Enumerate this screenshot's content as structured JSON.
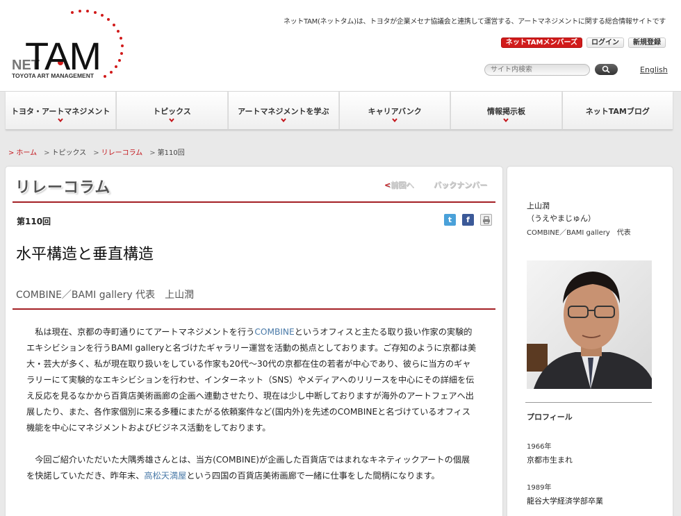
{
  "header": {
    "logo_net": "NET",
    "logo_tam": "TAM",
    "logo_sub": "TOYOTA ART MANAGEMENT",
    "tagline": "ネットTAM(ネットタム)は、トヨタが企業メセナ協議会と連携して運営する、アートマネジメントに関する総合情報サイトです",
    "members_btn": "ネットTAMメンバーズ",
    "login_btn": "ログイン",
    "register_btn": "新規登録",
    "search_placeholder": "サイト内検索",
    "english_link": "English",
    "accent_color": "#c4161c"
  },
  "nav": {
    "items": [
      {
        "label": "トヨタ・アートマネジメント"
      },
      {
        "label": "トピックス"
      },
      {
        "label": "アートマネジメントを学ぶ"
      },
      {
        "label": "キャリアバンク"
      },
      {
        "label": "情報掲示板"
      },
      {
        "label": "ネットTAMブログ"
      }
    ]
  },
  "breadcrumb": {
    "home": "ホーム",
    "topics": "トピックス",
    "relay": "リレーコラム",
    "current": "第110回",
    "separator": ">"
  },
  "main": {
    "section_title": "リレーコラム",
    "prev_link": "前回へ",
    "prev_arrow": "<",
    "backnumber_link": "バックナンバー",
    "issue_no": "第110回",
    "article_title": "水平構造と垂直構造",
    "author_line": "COMBINE／BAMI gallery 代表　上山潤",
    "paragraphs": [
      {
        "before": "私は現在、京都の寺町通りにてアートマネジメントを行う",
        "link": "COMBINE",
        "after": "というオフィスと主たる取り扱い作家の実験的エキシビションを行うBAMI galleryと名づけたギャラリー運営を活動の拠点としております。ご存知のように京都は美大・芸大が多く、私が現在取り扱いをしている作家も20代〜30代の京都在住の若者が中心であり、彼らに当方のギャラリーにて実験的なエキシビションを行わせ、インターネット（SNS）やメディアへのリリースを中心にその詳細を伝え反応を見るなかから百貨店美術画廊の企画へ連動させたり、現在は少し中断しておりますが海外のアートフェアへ出展したり、また、各作家個別に来る多種にまたがる依頼案件など(国内外)を先述のCOMBINEと名づけているオフィス機能を中心にマネジメントおよびビジネス活動をしております。"
      },
      {
        "before": "今回ご紹介いただいた大隅秀雄さんとは、当方(COMBINE)が企画した百貨店ではまれなキネティックアートの個展を快諾していただき、昨年末、",
        "link": "高松天満屋",
        "after": "という四国の百貨店美術画廊で一緒に仕事をした間柄になります。"
      }
    ]
  },
  "sidebar": {
    "name": "上山潤",
    "kana": "（うえやまじゅん）",
    "affiliation": "COMBINE／BAMI gallery　代表",
    "profile_heading": "プロフィール",
    "history": [
      {
        "year": "1966年",
        "event": "京都市生まれ"
      },
      {
        "year": "1989年",
        "event": "龍谷大学経済学部卒業"
      }
    ]
  }
}
